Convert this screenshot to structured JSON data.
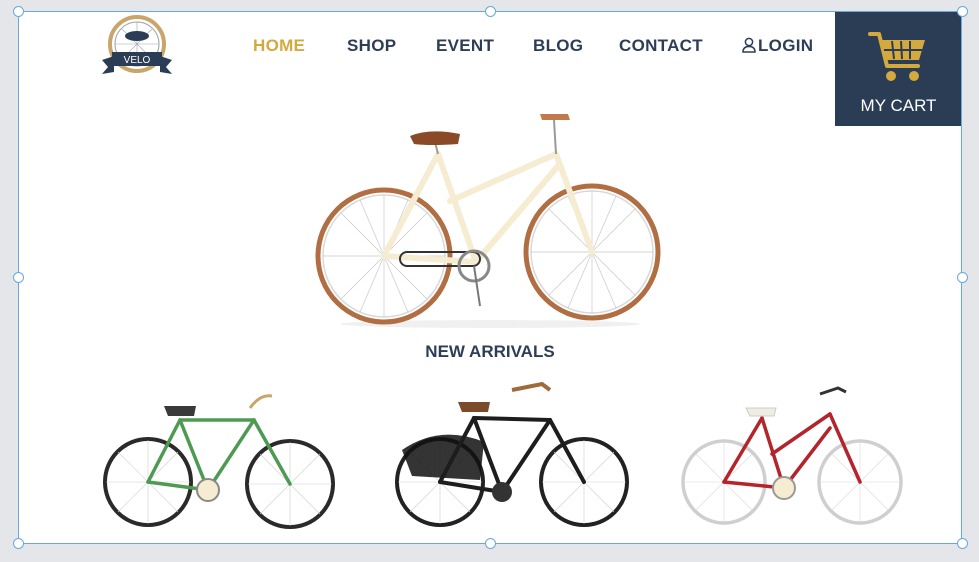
{
  "brand": {
    "logo_text": "VELO"
  },
  "nav": {
    "home": "HOME",
    "shop": "SHOP",
    "event": "EVENT",
    "blog": "BLOG",
    "contact": "CONTACT",
    "login": "LOGIN"
  },
  "cart": {
    "label": "MY CART"
  },
  "main": {
    "section_title": "NEW ARRIVALS"
  },
  "products": [
    {
      "icon": "green-bicycle"
    },
    {
      "icon": "black-bicycle"
    },
    {
      "icon": "red-bicycle"
    }
  ],
  "colors": {
    "navy": "#2b3d55",
    "gold": "#d4a93d",
    "selection": "#6aa7de"
  }
}
